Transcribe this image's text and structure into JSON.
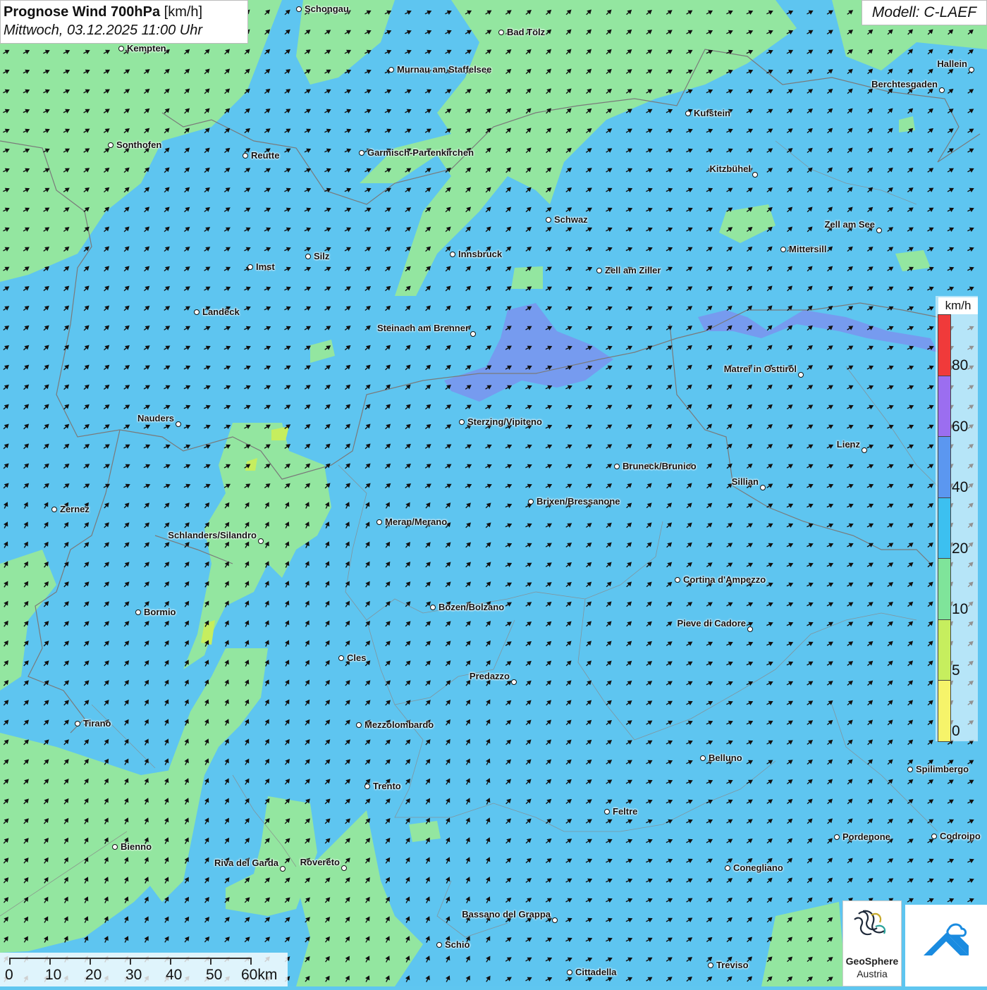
{
  "title": {
    "main": "Prognose Wind 700hPa",
    "unit": "[km/h]",
    "datetime": "Mittwoch, 03.12.2025 11:00 Uhr"
  },
  "model": "Modell: C-LAEF",
  "legend": {
    "unit": "km/h",
    "labels": [
      "80",
      "60",
      "40",
      "20",
      "10",
      "5",
      "0"
    ],
    "colors": [
      "#f03a3a",
      "#9b6ef0",
      "#5b97f0",
      "#3cc0f0",
      "#7fe49a",
      "#c6ee5e",
      "#f6f46a"
    ]
  },
  "scalebar": {
    "labels": [
      "0",
      "10",
      "20",
      "30",
      "40",
      "50",
      "60km"
    ]
  },
  "logos": {
    "geosphere_line1": "GeoSphere",
    "geosphere_line2": "Austria"
  },
  "cities": [
    {
      "id": "schongau",
      "name": "Schongau"
    },
    {
      "id": "bad-toelz",
      "name": "Bad Tölz"
    },
    {
      "id": "kempten",
      "name": "Kempten"
    },
    {
      "id": "murnau",
      "name": "Murnau am Staffelsee"
    },
    {
      "id": "hallein",
      "name": "Hallein"
    },
    {
      "id": "berchtesgaden",
      "name": "Berchtesgaden"
    },
    {
      "id": "kufstein",
      "name": "Kufstein"
    },
    {
      "id": "sonthofen",
      "name": "Sonthofen"
    },
    {
      "id": "reutte",
      "name": "Reutte"
    },
    {
      "id": "garmisch",
      "name": "Garmisch-Partenkirchen"
    },
    {
      "id": "kitzbuehel",
      "name": "Kitzbühel"
    },
    {
      "id": "schwaz",
      "name": "Schwaz"
    },
    {
      "id": "zell-am-see",
      "name": "Zell am See"
    },
    {
      "id": "innsbruck",
      "name": "Innsbruck"
    },
    {
      "id": "mittersill",
      "name": "Mittersill"
    },
    {
      "id": "silz",
      "name": "Silz"
    },
    {
      "id": "imst",
      "name": "Imst"
    },
    {
      "id": "zell-am-ziller",
      "name": "Zell am Ziller"
    },
    {
      "id": "landeck",
      "name": "Landeck"
    },
    {
      "id": "steinach",
      "name": "Steinach am Brenner"
    },
    {
      "id": "matrei",
      "name": "Matrei in Osttirol"
    },
    {
      "id": "nauders",
      "name": "Nauders"
    },
    {
      "id": "sterzing",
      "name": "Sterzing/Vipiteno"
    },
    {
      "id": "lienz",
      "name": "Lienz"
    },
    {
      "id": "bruneck",
      "name": "Bruneck/Brunico"
    },
    {
      "id": "sillian",
      "name": "Sillian"
    },
    {
      "id": "zernez",
      "name": "Zernez"
    },
    {
      "id": "brixen",
      "name": "Brixen/Bressanone"
    },
    {
      "id": "meran",
      "name": "Meran/Merano"
    },
    {
      "id": "schlanders",
      "name": "Schlanders/Silandro"
    },
    {
      "id": "cortina",
      "name": "Cortina d'Ampezzo"
    },
    {
      "id": "bozen",
      "name": "Bozen/Bolzano"
    },
    {
      "id": "bormio",
      "name": "Bormio"
    },
    {
      "id": "pieve",
      "name": "Pieve di Cadore"
    },
    {
      "id": "cles",
      "name": "Cles"
    },
    {
      "id": "predazzo",
      "name": "Predazzo"
    },
    {
      "id": "tirano",
      "name": "Tirano"
    },
    {
      "id": "mezzolombardo",
      "name": "Mezzolombardo"
    },
    {
      "id": "belluno",
      "name": "Belluno"
    },
    {
      "id": "spilimbergo",
      "name": "Spilimbergo"
    },
    {
      "id": "trento",
      "name": "Trento"
    },
    {
      "id": "feltre",
      "name": "Feltre"
    },
    {
      "id": "pordenone",
      "name": "Pordenone"
    },
    {
      "id": "codroipo",
      "name": "Codroipo"
    },
    {
      "id": "bienno",
      "name": "Bienno"
    },
    {
      "id": "riva",
      "name": "Riva del Garda"
    },
    {
      "id": "rovereto",
      "name": "Rovereto"
    },
    {
      "id": "conegliano",
      "name": "Conegliano"
    },
    {
      "id": "bassano",
      "name": "Bassano del Grappa"
    },
    {
      "id": "schio",
      "name": "Schio"
    },
    {
      "id": "treviso",
      "name": "Treviso"
    },
    {
      "id": "cittadella",
      "name": "Cittadella"
    }
  ]
}
